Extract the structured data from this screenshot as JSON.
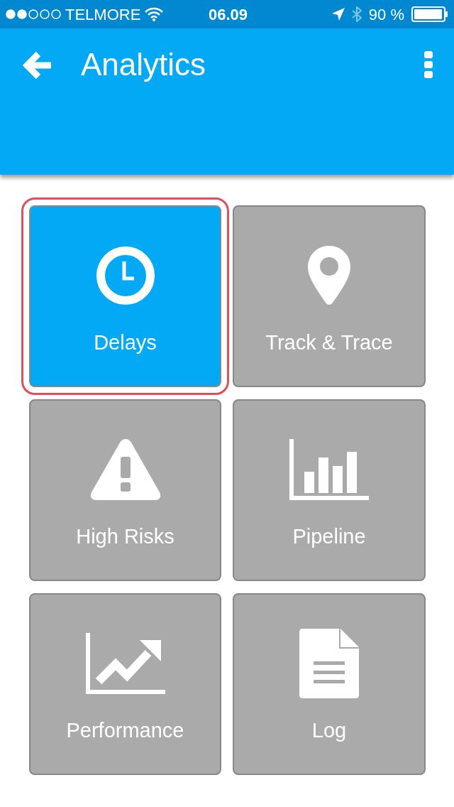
{
  "status_bar": {
    "carrier": "TELMORE",
    "time": "06.09",
    "battery": "90 %"
  },
  "header": {
    "title": "Analytics"
  },
  "tiles": [
    {
      "label": "Delays",
      "kind": "clock",
      "selected": true
    },
    {
      "label": "Track & Trace",
      "kind": "pin",
      "selected": false
    },
    {
      "label": "High Risks",
      "kind": "warning",
      "selected": false
    },
    {
      "label": "Pipeline",
      "kind": "bars",
      "selected": false
    },
    {
      "label": "Performance",
      "kind": "trend",
      "selected": false
    },
    {
      "label": "Log",
      "kind": "document",
      "selected": false
    }
  ]
}
